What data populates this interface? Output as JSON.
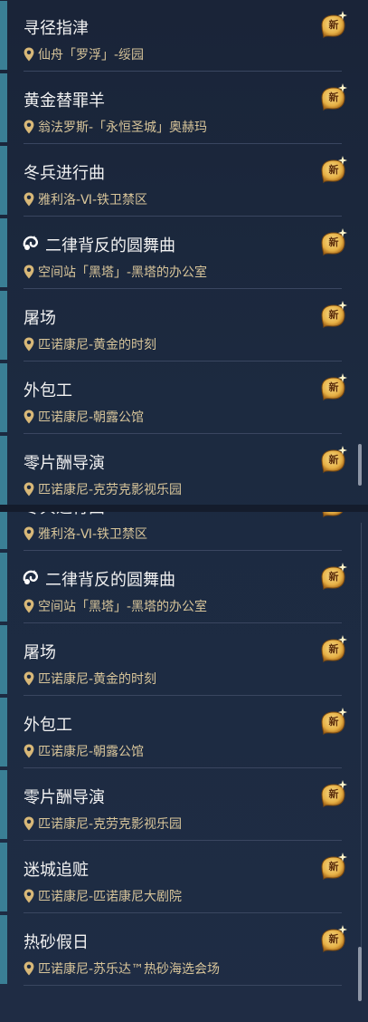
{
  "badge_label": "新",
  "top_list": [
    {
      "title": "寻径指津",
      "location": "仙舟「罗浮」-绥园",
      "icon": null
    },
    {
      "title": "黄金替罪羊",
      "location": "翁法罗斯-「永恒圣城」奥赫玛",
      "icon": null
    },
    {
      "title": "冬兵进行曲",
      "location": "雅利洛-Ⅵ-铁卫禁区",
      "icon": null
    },
    {
      "title": "二律背反的圆舞曲",
      "location": "空间站「黑塔」-黑塔的办公室",
      "icon": "special-quest-icon"
    },
    {
      "title": "屠场",
      "location": "匹诺康尼-黄金的时刻",
      "icon": null
    },
    {
      "title": "外包工",
      "location": "匹诺康尼-朝露公馆",
      "icon": null
    },
    {
      "title": "零片酬导演",
      "location": "匹诺康尼-克劳克影视乐园",
      "icon": null
    }
  ],
  "bottom_list": [
    {
      "title": "冬兵进行曲",
      "location": "雅利洛-Ⅵ-铁卫禁区",
      "icon": null
    },
    {
      "title": "二律背反的圆舞曲",
      "location": "空间站「黑塔」-黑塔的办公室",
      "icon": "special-quest-icon"
    },
    {
      "title": "屠场",
      "location": "匹诺康尼-黄金的时刻",
      "icon": null
    },
    {
      "title": "外包工",
      "location": "匹诺康尼-朝露公馆",
      "icon": null
    },
    {
      "title": "零片酬导演",
      "location": "匹诺康尼-克劳克影视乐园",
      "icon": null
    },
    {
      "title": "迷城追赃",
      "location": "匹诺康尼-匹诺康尼大剧院",
      "icon": null
    },
    {
      "title": "热砂假日",
      "location": "匹诺康尼-苏乐达™热砂海选会场",
      "icon": null
    }
  ],
  "colors": {
    "accent": "#3a7f95",
    "location_text": "#d8c59a",
    "badge_gold": "#e6b045"
  }
}
